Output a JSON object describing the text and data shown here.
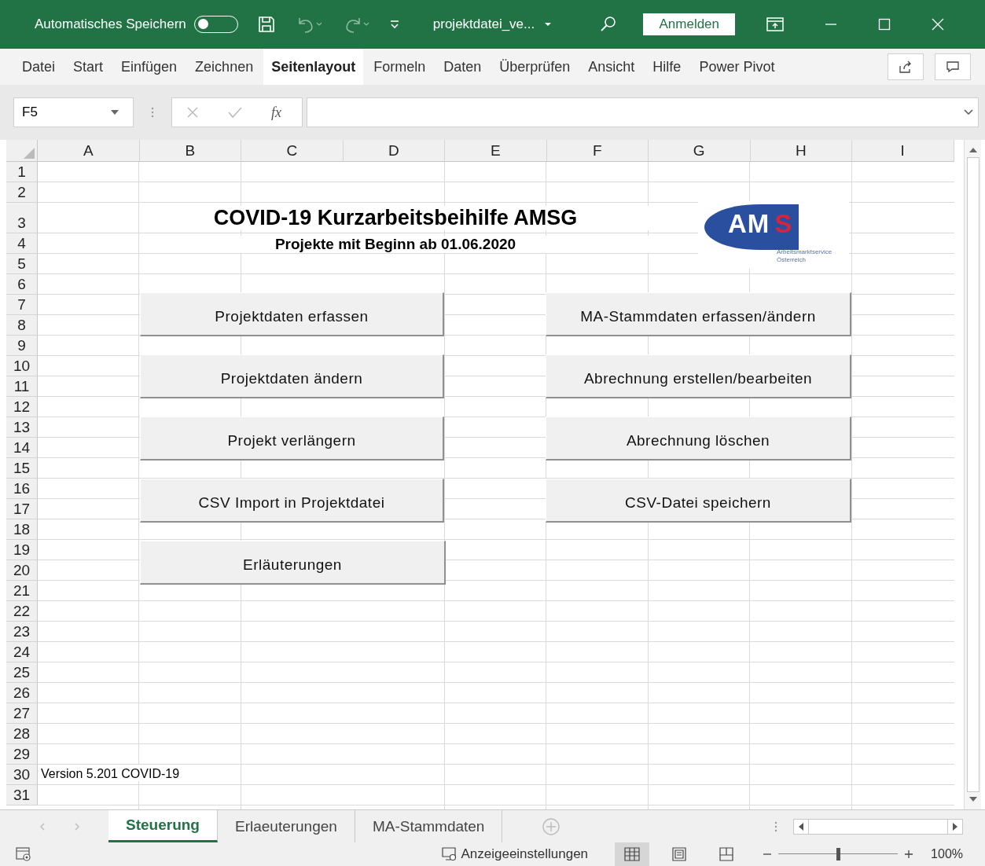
{
  "title_bar": {
    "autosave_label": "Automatisches Speichern",
    "autosave_on": false,
    "filename": "projektdatei_ve...",
    "sign_in": "Anmelden"
  },
  "ribbon_tabs": [
    {
      "label": "Datei",
      "selected": false
    },
    {
      "label": "Start",
      "selected": false
    },
    {
      "label": "Einfügen",
      "selected": false
    },
    {
      "label": "Zeichnen",
      "selected": false
    },
    {
      "label": "Seitenlayout",
      "selected": true
    },
    {
      "label": "Formeln",
      "selected": false
    },
    {
      "label": "Daten",
      "selected": false
    },
    {
      "label": "Überprüfen",
      "selected": false
    },
    {
      "label": "Ansicht",
      "selected": false
    },
    {
      "label": "Hilfe",
      "selected": false
    },
    {
      "label": "Power Pivot",
      "selected": false
    }
  ],
  "formula_bar": {
    "name_box": "F5",
    "function_label": "fx"
  },
  "columns": [
    "A",
    "B",
    "C",
    "D",
    "E",
    "F",
    "G",
    "H",
    "I"
  ],
  "rows": [
    "1",
    "2",
    "3",
    "4",
    "5",
    "6",
    "7",
    "8",
    "9",
    "10",
    "11",
    "12",
    "13",
    "14",
    "15",
    "16",
    "17",
    "18",
    "19",
    "20",
    "21",
    "22",
    "23",
    "24",
    "25",
    "26",
    "27",
    "28",
    "29",
    "30",
    "31"
  ],
  "sheet": {
    "title": "COVID-19 Kurzarbeitsbeihilfe AMSG",
    "subtitle": "Projekte mit Beginn ab 01.06.2020",
    "logo": {
      "mark": [
        "AM",
        "S"
      ],
      "caption": [
        "Arbeitsmarktservice",
        "Österreich"
      ]
    },
    "buttons_left": [
      "Projektdaten erfassen",
      "Projektdaten ändern",
      "Projekt verlängern",
      "CSV Import in Projektdatei",
      "Erläuterungen"
    ],
    "buttons_right": [
      "MA-Stammdaten erfassen/ändern",
      "Abrechnung erstellen/bearbeiten",
      "Abrechnung löschen",
      "CSV-Datei speichern"
    ],
    "version": "Version 5.201 COVID-19"
  },
  "sheet_tabs": [
    {
      "label": "Steuerung",
      "selected": true
    },
    {
      "label": "Erlaeuterungen",
      "selected": false
    },
    {
      "label": "MA-Stammdaten",
      "selected": false
    }
  ],
  "status_bar": {
    "display_settings": "Anzeigeeinstellungen",
    "view_buttons": [
      {
        "kind": "normal",
        "selected": true
      },
      {
        "kind": "page_layout",
        "selected": false
      },
      {
        "kind": "page_break",
        "selected": false
      }
    ],
    "zoom_slider": {
      "level": 0.5
    },
    "zoom": "100%"
  }
}
